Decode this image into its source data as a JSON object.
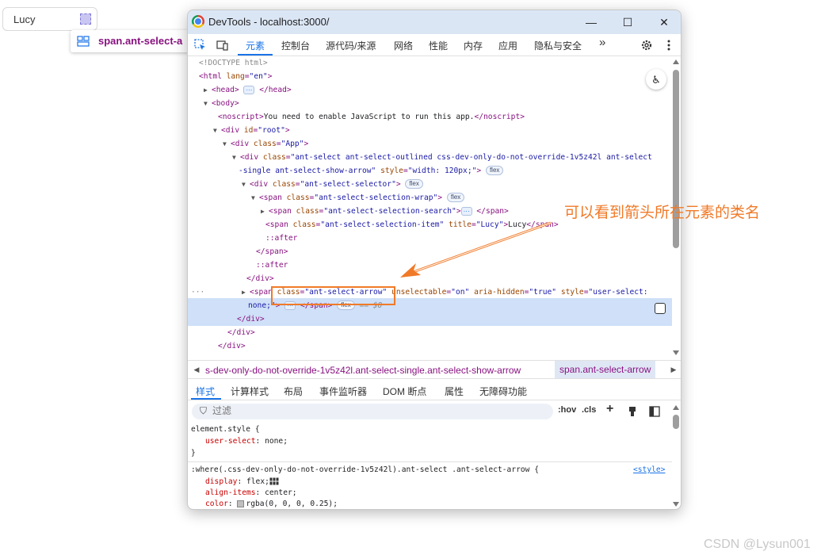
{
  "page": {
    "select_value": "Lucy",
    "tooltip": "span.ant-select-a"
  },
  "window": {
    "title": "DevTools - localhost:3000/",
    "minimize": "—",
    "maximize": "☐",
    "close": "✕"
  },
  "tabs": [
    "元素",
    "控制台",
    "源代码/来源",
    "网络",
    "性能",
    "内存",
    "应用",
    "隐私与安全"
  ],
  "more_tabs": "»",
  "dom": {
    "doctype": "<!DOCTYPE html>",
    "html_open_tag": "<html ",
    "html_attr": "lang",
    "html_val": "\"en\"",
    "head_open": "<head>",
    "head_close": "</head>",
    "body_open": "<body>",
    "noscript_open": "<noscript>",
    "noscript_text": "You need to enable JavaScript to run this app.",
    "noscript_close": "</noscript>",
    "div_root_tag": "<div ",
    "div_root_attr": "id",
    "div_root_val": "\"root\"",
    "div_app_attr": "class",
    "div_app_val": "\"App\"",
    "select_div_val_1": "\"ant-select ant-select-outlined css-dev-only-do-not-override-1v5z42l ant-select",
    "select_div_val_2": "-single ant-select-show-arrow\"",
    "select_div_style_attr": "style",
    "select_div_style_val": "\"width: 120px;\"",
    "selector_val": "\"ant-select-selector\"",
    "wrap_val": "\"ant-select-selection-wrap\"",
    "search_val": "\"ant-select-selection-search\"",
    "item_val": "\"ant-select-selection-item\"",
    "item_title_attr": "title",
    "item_title_val": "\"Lucy\"",
    "item_text": "Lucy",
    "after": "::after",
    "span_close": "</span>",
    "div_close": "</div>",
    "arrow_span_open": "<span ",
    "arrow_class_attr": "class",
    "arrow_class_val": "\"ant-select-arrow\"",
    "arrow_unsel_attr": "unselectable",
    "arrow_unsel_val": "\"on\"",
    "arrow_aria_attr": "aria-hidden",
    "arrow_aria_val": "\"true\"",
    "arrow_style_attr": "style",
    "arrow_style_val_1": "\"user-select:",
    "arrow_style_val_2": "none;\"",
    "dollar": "== $0",
    "badge_flex": "flex",
    "ellipsis": "···",
    "row_dots": "···"
  },
  "breadcrumb": {
    "left": "s-dev-only-do-not-override-1v5z42l.ant-select-single.ant-select-show-arrow",
    "active": "span.ant-select-arrow"
  },
  "subtabs": [
    "样式",
    "计算样式",
    "布局",
    "事件监听器",
    "DOM 断点",
    "属性",
    "无障碍功能"
  ],
  "filter": {
    "placeholder": "过滤",
    "hov": ":hov",
    "cls": ".cls",
    "plus": "+"
  },
  "styles": {
    "element_style": "element.style {",
    "user_select_prop": "user-select",
    "user_select_val": "none;",
    "close_brace": "}",
    "where_selector": ":where(.css-dev-only-do-not-override-1v5z42l).ant-select .ant-select-arrow {",
    "source": "<style>",
    "display_prop": "display",
    "display_val": "flex;",
    "align_prop": "align-items",
    "align_val": "center;",
    "color_prop": "color",
    "color_val": "rgba(0, 0, 0, 0.25);"
  },
  "annotation": "可以看到箭头所在元素的类名",
  "watermark": "CSDN @Lysun001",
  "colors": {
    "accent": "#1a73e8",
    "annotation": "#f07a28",
    "tag": "#881280",
    "attribute": "#994500",
    "value": "#1a1aa6",
    "selected_row": "#cfe0f8"
  }
}
